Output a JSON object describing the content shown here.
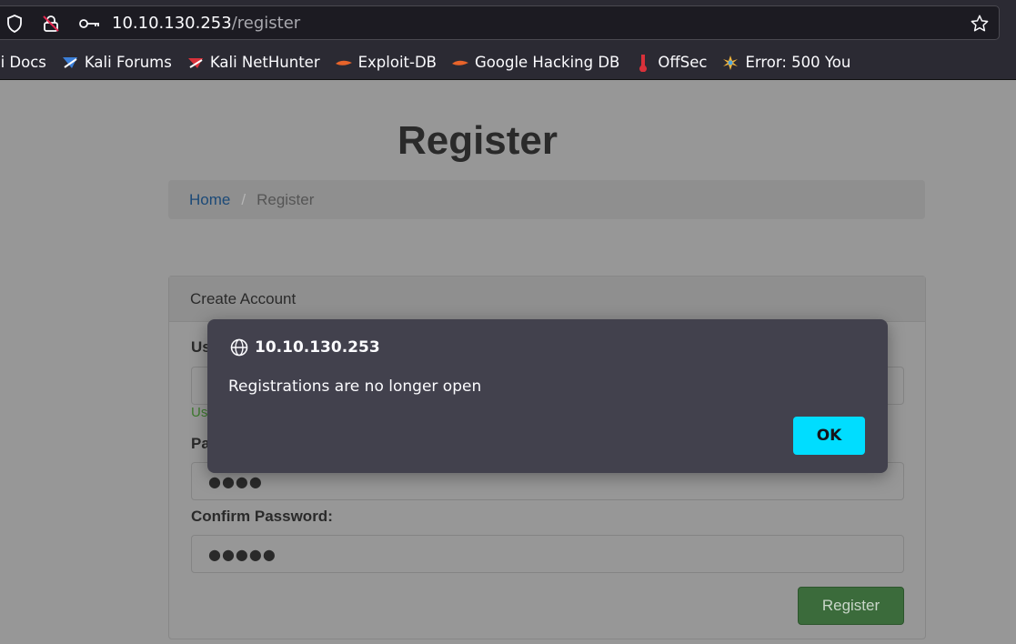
{
  "browser": {
    "url_host": "10.10.130.253",
    "url_path": "/register",
    "icons": [
      "shield-icon",
      "insecure-lock-icon",
      "key-icon",
      "star-icon"
    ]
  },
  "bookmarks": [
    {
      "label": "li Docs",
      "icon": "kali-docs-icon"
    },
    {
      "label": "Kali Forums",
      "icon": "kali-forums-icon"
    },
    {
      "label": "Kali NetHunter",
      "icon": "kali-nethunter-icon"
    },
    {
      "label": "Exploit-DB",
      "icon": "exploit-db-icon"
    },
    {
      "label": "Google Hacking DB",
      "icon": "ghdb-icon"
    },
    {
      "label": "OffSec",
      "icon": "offsec-icon"
    },
    {
      "label": "Error: 500 You",
      "icon": "error-500-icon"
    }
  ],
  "page": {
    "title": "Register",
    "breadcrumb": {
      "home": "Home",
      "separator": "/",
      "current": "Register"
    },
    "panel_heading": "Create Account",
    "username_label_visible": "Us",
    "username_hint_visible": "Us",
    "password_label_visible": "Pa",
    "password_value": "●●●●",
    "confirm_label": "Confirm Password:",
    "confirm_value": "●●●●●",
    "submit_label": "Register"
  },
  "dialog": {
    "origin": "10.10.130.253",
    "message": "Registrations are no longer open",
    "ok_label": "OK"
  },
  "colors": {
    "dialog_button": "#00ddff",
    "register_button": "#3b6b3b",
    "breadcrumb_link": "#1c4a78"
  }
}
